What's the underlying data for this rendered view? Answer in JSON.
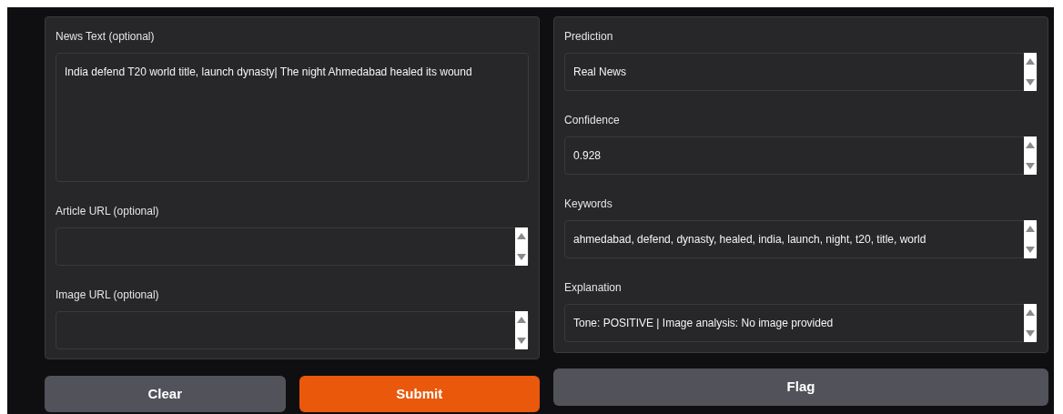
{
  "inputs": [
    {
      "label": "News Text (optional)",
      "kind": "textarea",
      "value": "India defend T20 world title, launch dynasty| The night Ahmedabad healed its wound"
    },
    {
      "label": "Article URL (optional)",
      "kind": "textbox"
    },
    {
      "label": "Image URL (optional)",
      "kind": "textbox"
    }
  ],
  "outputs": [
    {
      "label": "Prediction",
      "value": "Real News"
    },
    {
      "label": "Confidence",
      "value": "0.928"
    },
    {
      "label": "Keywords",
      "value": "ahmedabad, defend, dynasty, healed, india, launch, night, t20, title, world"
    },
    {
      "label": "Explanation",
      "value": "Tone: POSITIVE | Image analysis: No image provided"
    }
  ],
  "input_buttons": [
    {
      "label": "Clear",
      "kind": "secondary"
    },
    {
      "label": "Submit",
      "kind": "primary"
    }
  ],
  "output_buttons": [
    {
      "label": "Flag",
      "kind": "secondary"
    }
  ]
}
